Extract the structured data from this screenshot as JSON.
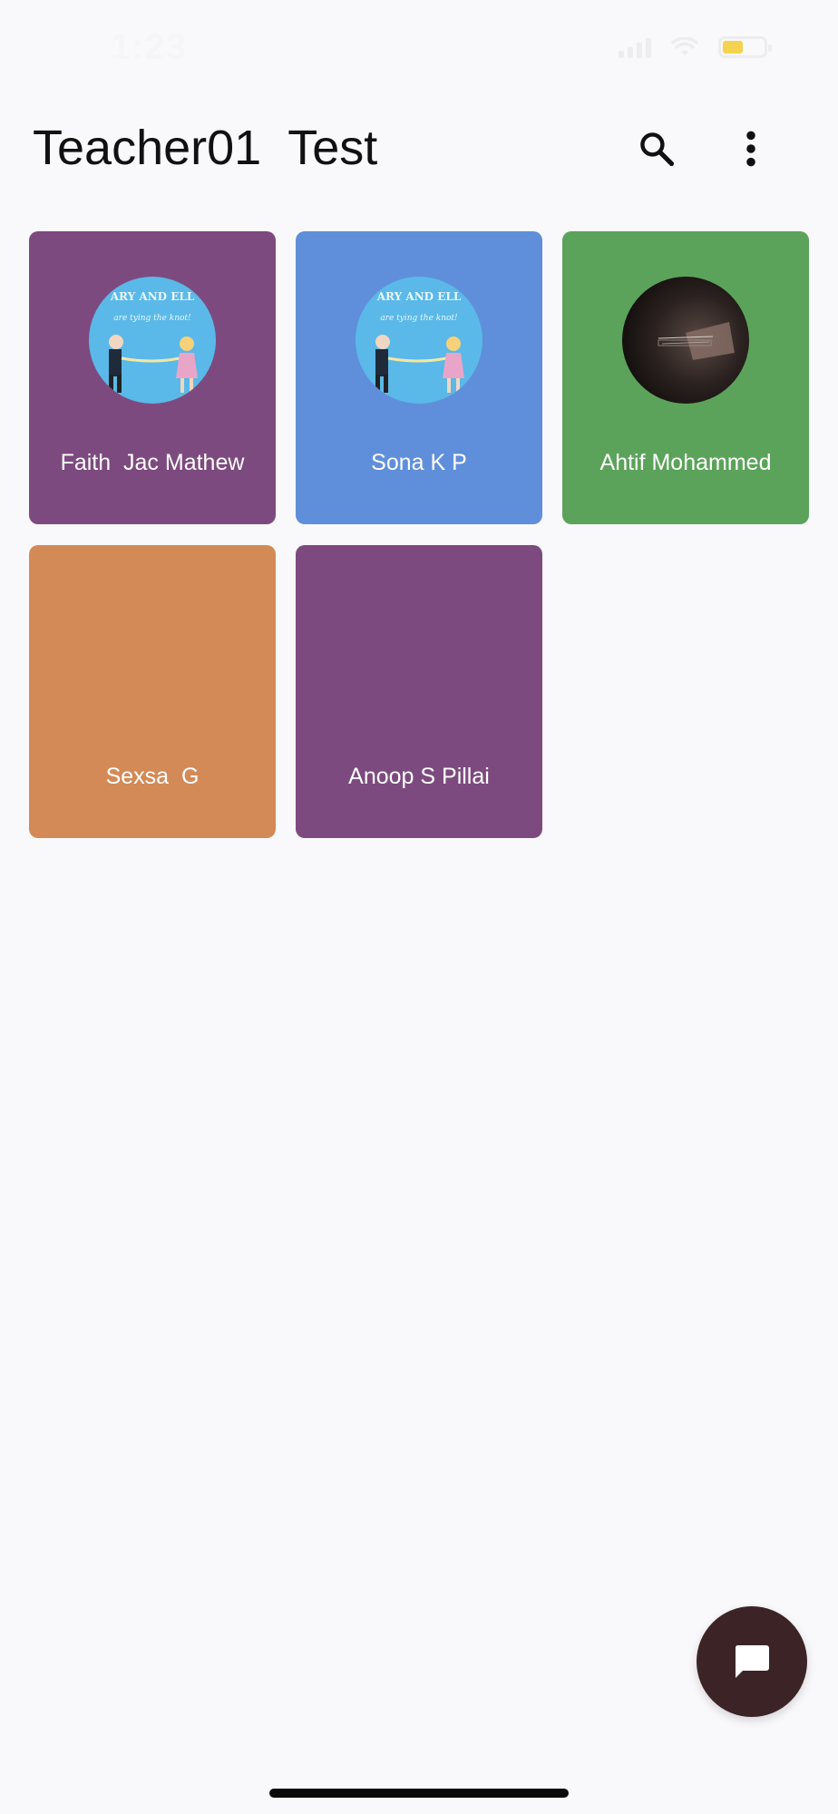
{
  "status_bar": {
    "time": "1:23"
  },
  "header": {
    "title": "Teacher01  Test",
    "search_icon": "search-icon",
    "more_icon": "more-vert-icon"
  },
  "students": [
    {
      "name": "Faith  Jac Mathew",
      "color": "#7d4a7f",
      "avatar": "cartoon-couple"
    },
    {
      "name": "Sona K P",
      "color": "#5f8fda",
      "avatar": "cartoon-couple"
    },
    {
      "name": "Ahtif Mohammed",
      "color": "#5ba35a",
      "avatar": "dark-photo"
    },
    {
      "name": "Sexsa  G",
      "color": "#d38a56",
      "avatar": null
    },
    {
      "name": "Anoop S Pillai",
      "color": "#7d4a7f",
      "avatar": null
    }
  ],
  "fab": {
    "icon": "chat-icon"
  }
}
